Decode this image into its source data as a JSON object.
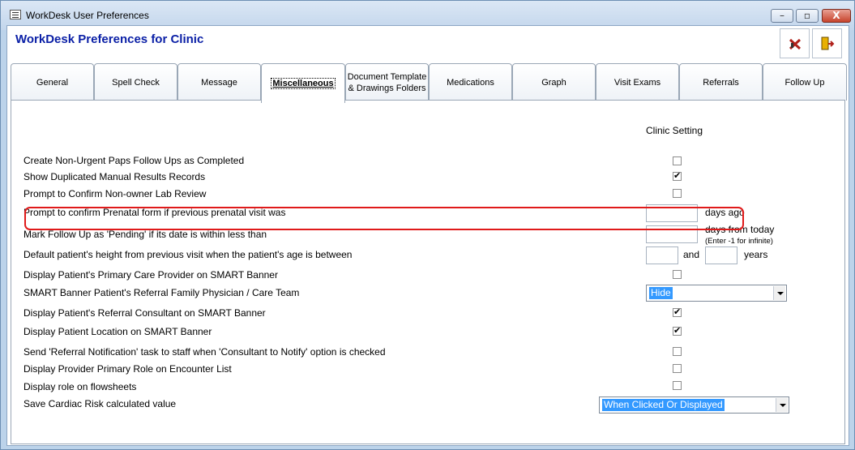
{
  "window": {
    "title": "WorkDesk User Preferences",
    "min_glyph": "–",
    "max_glyph": "▫",
    "close_glyph": "X"
  },
  "page_title": "WorkDesk Preferences for Clinic",
  "tabs": [
    {
      "label": "General"
    },
    {
      "label": "Spell Check"
    },
    {
      "label": "Message"
    },
    {
      "label": "Miscellaneous",
      "active": true
    },
    {
      "label": "Document Template",
      "label2": "& Drawings Folders"
    },
    {
      "label": "Medications"
    },
    {
      "label": "Graph"
    },
    {
      "label": "Visit Exams"
    },
    {
      "label": "Referrals"
    },
    {
      "label": "Follow Up"
    }
  ],
  "column_header": "Clinic Setting",
  "settings": [
    {
      "label": "Create Non-Urgent Paps Follow Ups as Completed",
      "checked": false
    },
    {
      "label": "Show Duplicated Manual Results Records",
      "checked": true
    },
    {
      "label": "Prompt to Confirm Non-owner Lab Review",
      "checked": false
    },
    {
      "label": "Prompt to confirm Prenatal form if previous prenatal visit was",
      "suffix": "days ago",
      "value": ""
    },
    {
      "label": "Mark Follow Up as 'Pending' if its date is within less than",
      "suffix": "days from today",
      "hint": "(Enter -1 for infinite)",
      "value": ""
    },
    {
      "label": "Default patient's height from previous visit when the patient's age is between",
      "between": "and",
      "suffix": "years",
      "value1": "",
      "value2": ""
    },
    {
      "label": "Display Patient's Primary Care Provider on SMART Banner",
      "checked": false
    },
    {
      "label": "SMART Banner Patient's Referral Family Physician / Care Team",
      "selected": "Hide"
    },
    {
      "label": "Display Patient's Referral Consultant on SMART Banner",
      "checked": true
    },
    {
      "label": "Display Patient Location on  SMART Banner",
      "checked": true
    },
    {
      "label": "Send 'Referral Notification' task to staff when 'Consultant to Notify' option is checked",
      "checked": false
    },
    {
      "label": "Display Provider Primary Role on Encounter List",
      "checked": false
    },
    {
      "label": "Display role on flowsheets",
      "checked": false
    },
    {
      "label": "Save Cardiac Risk calculated value",
      "selected": "When Clicked Or Displayed"
    }
  ],
  "colors": {
    "title_blue": "#0a1fa6",
    "highlight": "#e01a1a",
    "selection": "#3399ff"
  }
}
